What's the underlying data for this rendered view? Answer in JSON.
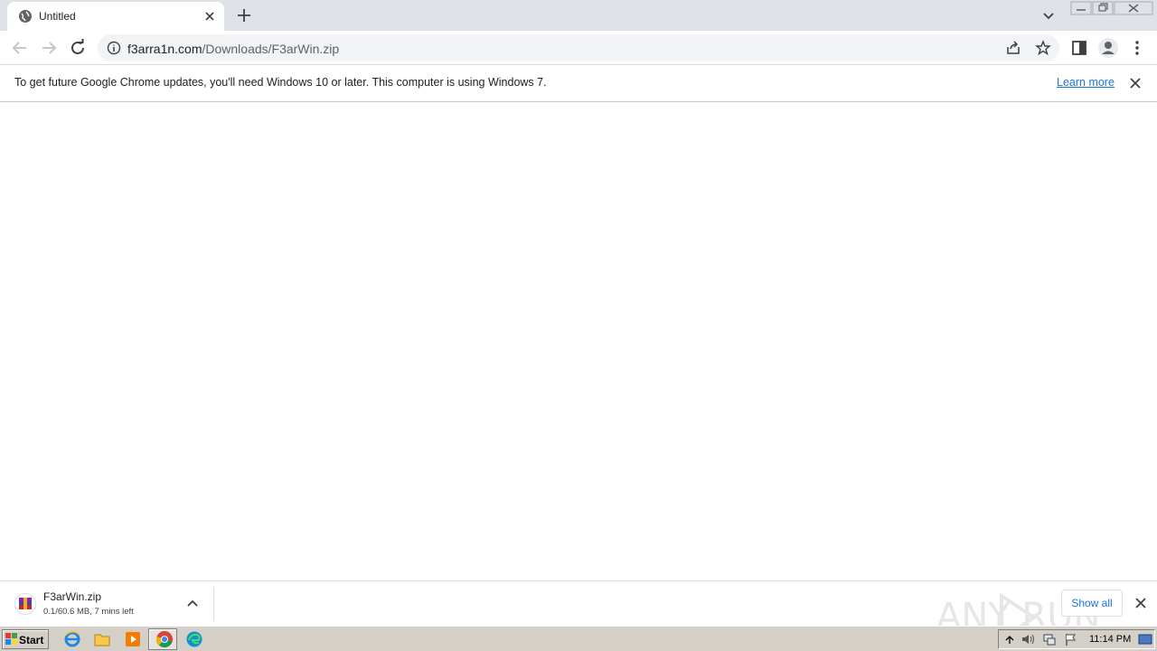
{
  "tab": {
    "title": "Untitled"
  },
  "toolbar": {
    "url_domain": "f3arra1n.com",
    "url_path": "/Downloads/F3arWin.zip"
  },
  "infobar": {
    "message": "To get future Google Chrome updates, you'll need Windows 10 or later. This computer is using Windows 7.",
    "link": "Learn more"
  },
  "download": {
    "filename": "F3arWin.zip",
    "status": "0.1/60.6 MB, 7 mins left",
    "show_all": "Show all"
  },
  "watermark": {
    "text": "ANY RUN"
  },
  "taskbar": {
    "start": "Start",
    "clock": "11:14 PM"
  },
  "colors": {
    "tabstrip": "#dee1e6",
    "link": "#1a73e8",
    "taskbar": "#d4d0c8"
  }
}
